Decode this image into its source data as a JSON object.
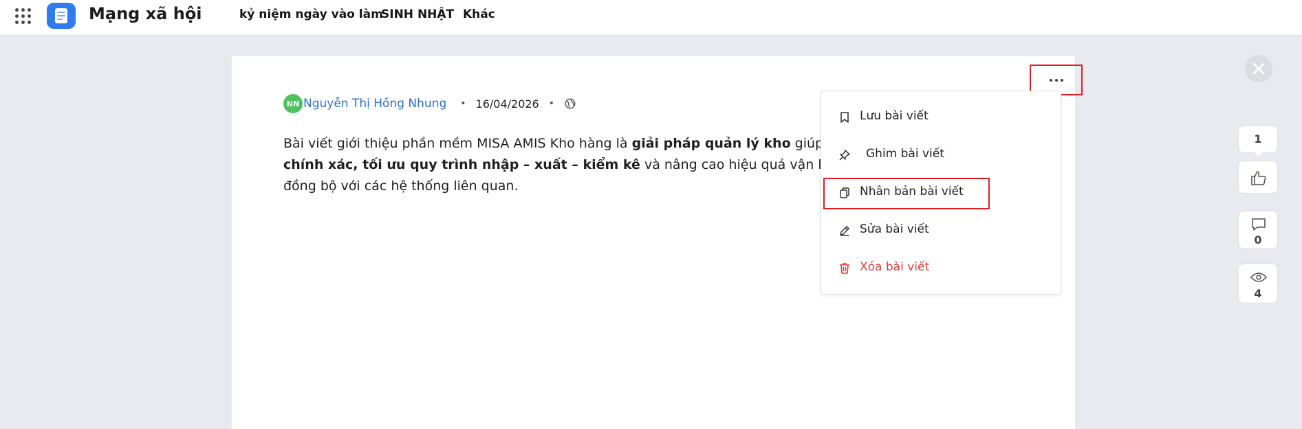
{
  "header": {
    "app_title": "Mạng xã hội",
    "nav": [
      {
        "label": "kỷ niệm ngày vào làm"
      },
      {
        "label": "SINH NHẬT"
      },
      {
        "label": "Khác"
      }
    ]
  },
  "post": {
    "author_initials": "NN",
    "author_name": "Nguyễn Thị Hồng Nhung",
    "date": "16/04/2026",
    "visibility_icon": "globe-icon",
    "body": {
      "line1_a": "Bài viết giới thiệu phần mềm MISA AMIS Kho hàng là ",
      "line1_b": "giải pháp quản lý kho",
      "line1_c": " giúp doan",
      "line2_a": "chính xác, tối ưu quy trình nhập – xuất – kiểm kê",
      "line2_b": " và nâng cao hiệu quả vận hành thôn",
      "line3": "đồng bộ với các hệ thống liên quan."
    }
  },
  "menu": {
    "items": [
      {
        "label": "Lưu bài viết",
        "icon": "bookmark-icon"
      },
      {
        "label": "Ghim bài viết",
        "icon": "pin-icon"
      },
      {
        "label": "Nhân bản bài viết",
        "icon": "duplicate-icon"
      },
      {
        "label": "Sửa bài viết",
        "icon": "pencil-icon"
      },
      {
        "label": "Xóa bài viết",
        "icon": "trash-icon"
      }
    ]
  },
  "rail": {
    "likes": "1",
    "comments": "0",
    "views": "4"
  },
  "colors": {
    "accent": "#2d6fd3",
    "danger": "#e53935",
    "highlight": "#e51b23",
    "avatar": "#4cc35e"
  }
}
